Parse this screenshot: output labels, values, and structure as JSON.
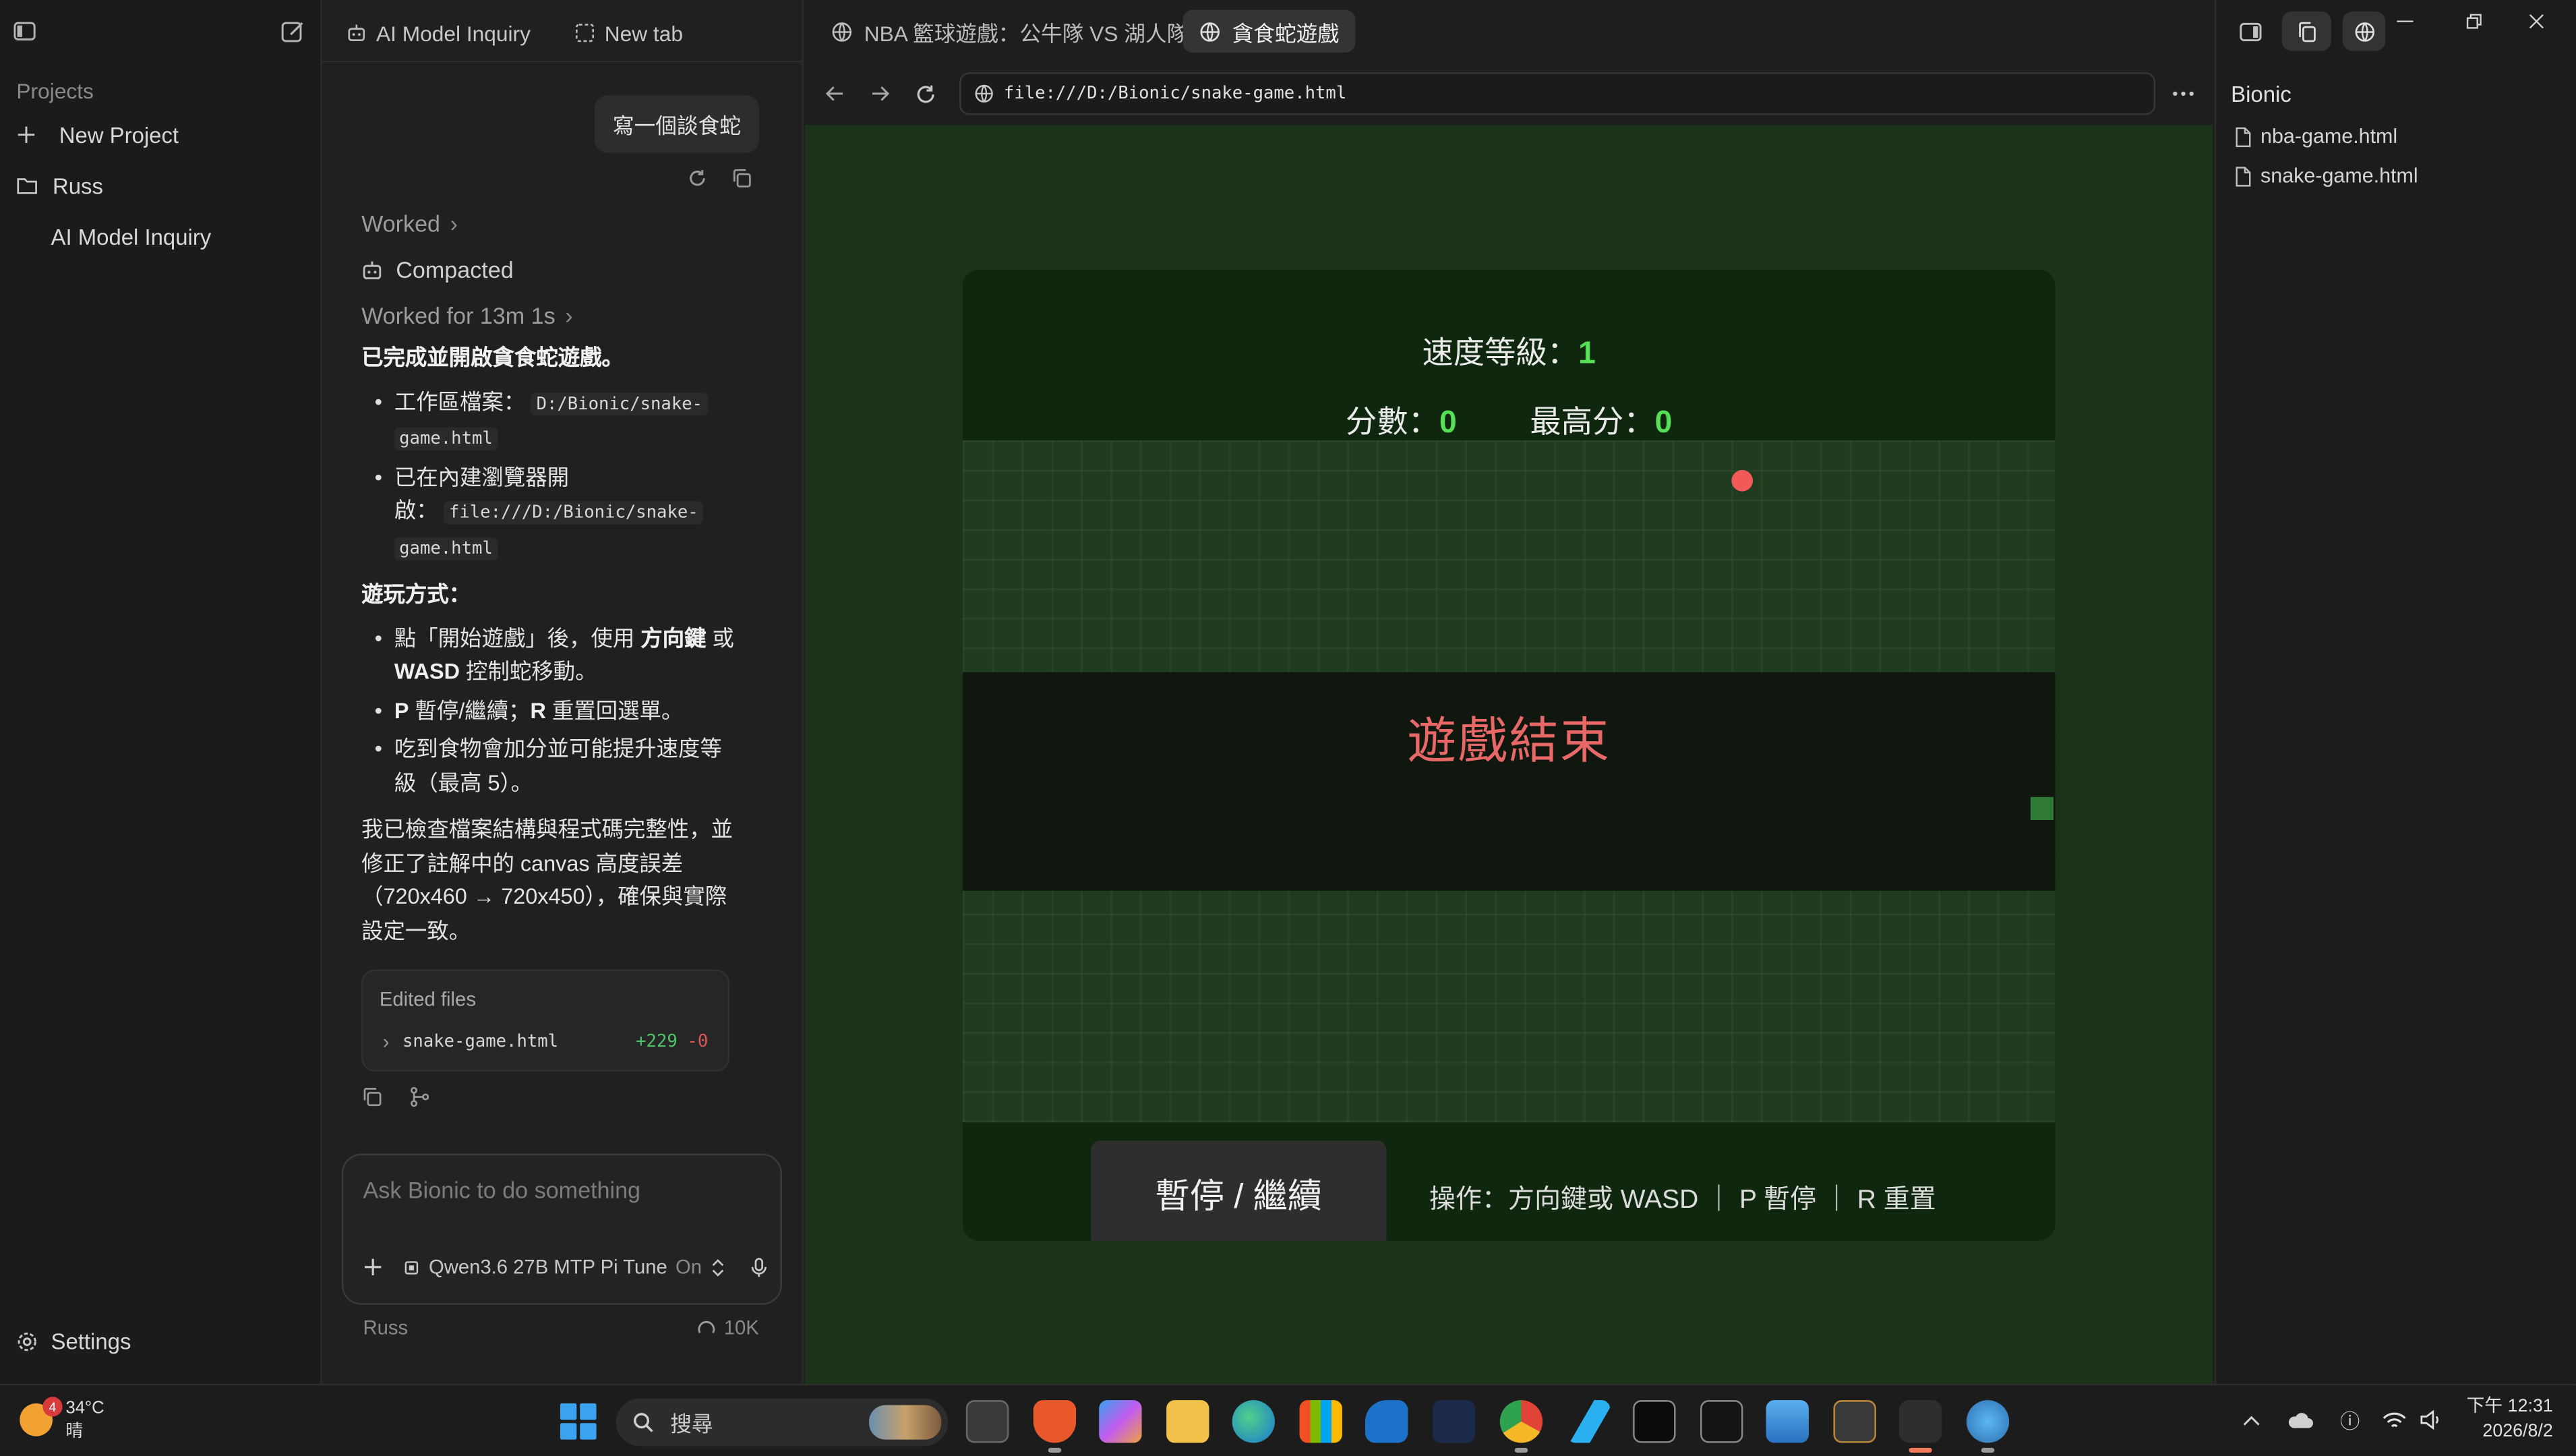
{
  "sidebar": {
    "projects_heading": "Projects",
    "new_project": "New Project",
    "folder": "Russ",
    "thread": "AI Model Inquiry",
    "settings": "Settings"
  },
  "chat": {
    "tabs": [
      "AI Model Inquiry",
      "New tab"
    ],
    "user_message": "寫一個談食蛇",
    "worked": "Worked",
    "compacted": "Compacted",
    "worked_for": "Worked for 13m 1s",
    "done_title": "已完成並開啟貪食蛇遊戲。",
    "b1_label": "工作區檔案：",
    "b1_code_a": "D:/Bionic/snake-",
    "b1_code_b": "game.html",
    "b2_label_a": "已在內建瀏覽器開",
    "b2_label_b": "啟：",
    "b2_code_a": "file:///D:/Bionic/snake-",
    "b2_code_b": "game.html",
    "howto_title": "遊玩方式：",
    "h1_a": "點「開始遊戲」後，使用",
    "h1_bold": "方向鍵",
    "h1_or": "或",
    "h1_wasd": "WASD",
    "h1_b": "控制蛇移動。",
    "h2_p": "P",
    "h2_a": "暫停/繼續；",
    "h2_r": "R",
    "h2_b": "重置回選單。",
    "h3": "吃到食物會加分並可能提升速度等級（最高 5）。",
    "para": "我已檢查檔案結構與程式碼完整性，並修正了註解中的 canvas 高度誤差（720x460 → 720x450），確保與實際設定一致。",
    "edited_heading": "Edited files",
    "edited_file": "snake-game.html",
    "edited_add": "+229",
    "edited_del": "-0",
    "composer_placeholder": "Ask Bionic to do something",
    "model": "Qwen3.6 27B MTP Pi Tune",
    "model_state": "On",
    "user": "Russ",
    "tokens": "10K"
  },
  "browser": {
    "tabs": [
      "NBA 籃球遊戲：公牛隊 VS 湖人隊",
      "貪食蛇遊戲"
    ],
    "url": "file:///D:/Bionic/snake-game.html"
  },
  "game": {
    "level_label": "速度等級：",
    "level": "1",
    "score_label": "分數：",
    "score": "0",
    "high_label": "最高分：",
    "high": "0",
    "game_over": "遊戲結束",
    "pause_button": "暫停 / 繼續",
    "help": "操作：方向鍵或 WASD ｜ P 暫停 ｜ R 重置"
  },
  "right_panel": {
    "title": "Bionic",
    "files": [
      "nba-game.html",
      "snake-game.html"
    ]
  },
  "taskbar": {
    "weather_temp": "34°C",
    "weather_desc": "晴",
    "weather_badge": "4",
    "search_placeholder": "搜尋",
    "time": "下午 12:31",
    "date": "2026/8/2"
  },
  "colors": {
    "game_bg": "#1a3319",
    "food": "#f25a5a",
    "snake": "#2f7a34",
    "score_number": "#55e055",
    "game_over_text": "#e86868"
  }
}
